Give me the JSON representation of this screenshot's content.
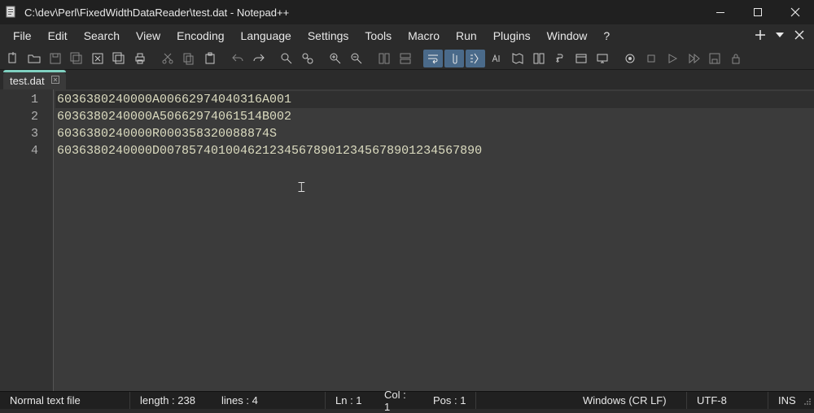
{
  "titlebar": {
    "title": "C:\\dev\\Perl\\FixedWidthDataReader\\test.dat - Notepad++"
  },
  "menubar": {
    "items": [
      "File",
      "Edit",
      "Search",
      "View",
      "Encoding",
      "Language",
      "Settings",
      "Tools",
      "Macro",
      "Run",
      "Plugins",
      "Window",
      "?"
    ]
  },
  "tab": {
    "label": "test.dat"
  },
  "editor": {
    "lines": [
      "6036380240000A00662974040316A001",
      "6036380240000A50662974061514B002",
      "6036380240000R000358320088874S",
      "6036380240000D00785740100462123456789012345678901234567890"
    ]
  },
  "status": {
    "filetype": "Normal text file",
    "length": "length : 238",
    "lines": "lines : 4",
    "ln": "Ln : 1",
    "col": "Col : 1",
    "pos": "Pos : 1",
    "eol": "Windows (CR LF)",
    "encoding": "UTF-8",
    "mode": "INS"
  }
}
